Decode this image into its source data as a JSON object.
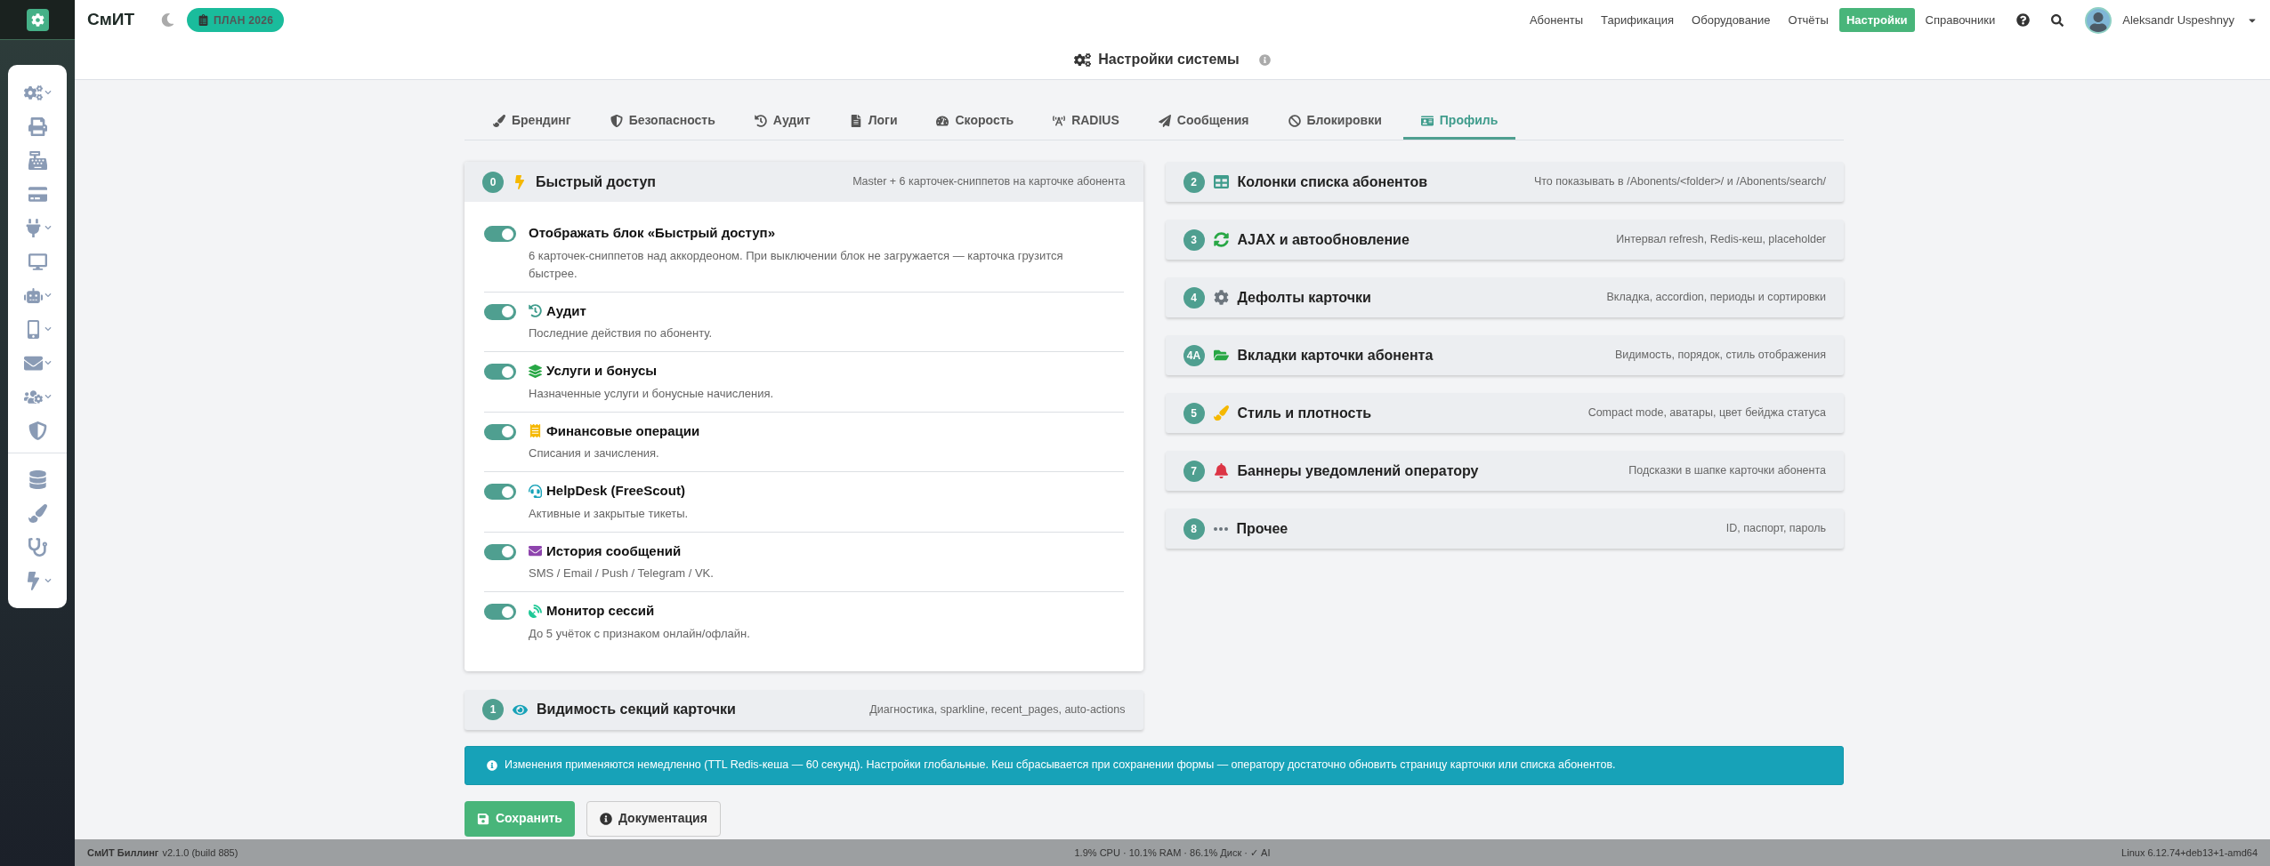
{
  "brand": {
    "name": "СмИТ",
    "badge": "ПЛАН 2026"
  },
  "nav": [
    {
      "label": "Абоненты",
      "selected": false
    },
    {
      "label": "Тарификация",
      "selected": false
    },
    {
      "label": "Оборудование",
      "selected": false
    },
    {
      "label": "Отчёты",
      "selected": false
    },
    {
      "label": "Настройки",
      "selected": true
    },
    {
      "label": "Справочники",
      "selected": false
    }
  ],
  "user": {
    "name": "Aleksandr Uspeshnyy"
  },
  "sidebar": {
    "groups": [
      {
        "items": [
          {
            "has_submenu": true
          },
          {
            "has_submenu": false
          },
          {
            "has_submenu": false
          },
          {
            "has_submenu": false
          },
          {
            "has_submenu": true
          },
          {
            "has_submenu": false
          },
          {
            "has_submenu": true
          },
          {
            "has_submenu": true
          },
          {
            "has_submenu": true
          },
          {
            "has_submenu": true
          },
          {
            "has_submenu": false
          }
        ]
      },
      {
        "items": [
          {
            "has_submenu": false
          },
          {
            "has_submenu": false
          },
          {
            "has_submenu": false
          },
          {
            "has_submenu": true
          }
        ]
      }
    ]
  },
  "page_title": "Настройки системы",
  "tabs": [
    {
      "label": "Брендинг",
      "selected": false
    },
    {
      "label": "Безопасность",
      "selected": false
    },
    {
      "label": "Аудит",
      "selected": false
    },
    {
      "label": "Логи",
      "selected": false
    },
    {
      "label": "Скорость",
      "selected": false
    },
    {
      "label": "RADIUS",
      "selected": false
    },
    {
      "label": "Сообщения",
      "selected": false
    },
    {
      "label": "Блокировки",
      "selected": false
    },
    {
      "label": "Профиль",
      "selected": true
    }
  ],
  "quick_access": {
    "number": "0",
    "title": "Быстрый доступ",
    "summary": "Master + 6 карточек-сниппетов на карточке абонента",
    "expanded": true,
    "settings": [
      {
        "title": "Отображать блок «Быстрый доступ»",
        "description": "6 карточек-сниппетов над аккордеоном. При выключении блок не загружается — карточка грузится быстрее.",
        "on": true
      },
      {
        "title": "Аудит",
        "description": "Последние действия по абоненту.",
        "on": true
      },
      {
        "title": "Услуги и бонусы",
        "description": "Назначенные услуги и бонусные начисления.",
        "on": true
      },
      {
        "title": "Финансовые операции",
        "description": "Списания и зачисления.",
        "on": true
      },
      {
        "title": "HelpDesk (FreeScout)",
        "description": "Активные и закрытые тикеты.",
        "on": true
      },
      {
        "title": "История сообщений",
        "description": "SMS / Email / Push / Telegram / VK.",
        "on": true
      },
      {
        "title": "Монитор сессий",
        "description": "До 5 учёток с признаком онлайн/офлайн.",
        "on": true
      }
    ]
  },
  "sections_left": [
    {
      "number": "1",
      "title": "Видимость секций карточки",
      "summary": "Диагностика, sparkline, recent_pages, auto-actions"
    }
  ],
  "sections_right": [
    {
      "number": "2",
      "title": "Колонки списка абонентов",
      "summary": "Что показывать в /Abonents/<folder>/ и /Abonents/search/"
    },
    {
      "number": "3",
      "title": "AJAX и автообновление",
      "summary": "Интервал refresh, Redis-кеш, placeholder"
    },
    {
      "number": "4",
      "title": "Дефолты карточки",
      "summary": "Вкладка, accordion, периоды и сортировки"
    },
    {
      "number": "4A",
      "title": "Вкладки карточки абонента",
      "summary": "Видимость, порядок, стиль отображения"
    },
    {
      "number": "5",
      "title": "Стиль и плотность",
      "summary": "Compact mode, аватары, цвет бейджа статуса"
    },
    {
      "number": "7",
      "title": "Баннеры уведомлений оператору",
      "summary": "Подсказки в шапке карточки абонента"
    },
    {
      "number": "8",
      "title": "Прочее",
      "summary": "ID, паспорт, пароль"
    }
  ],
  "notice": "Изменения применяются немедленно (TTL Redis-кеша — 60 секунд). Настройки глобальные. Кеш сбрасывается при сохранении формы — оператору достаточно обновить страницу карточки или списка абонентов.",
  "buttons": [
    {
      "label": "Сохранить",
      "kind": "primary"
    },
    {
      "label": "Документация",
      "kind": "secondary"
    }
  ],
  "status_bar": {
    "product": "СмИТ Биллинг",
    "version": "v2.1.0 (build 885)",
    "metrics": "1.9% CPU · 10.1% RAM · 86.1% Диск · ✓ AI",
    "system": "Linux 6.12.74+deb13+1-amd64"
  }
}
